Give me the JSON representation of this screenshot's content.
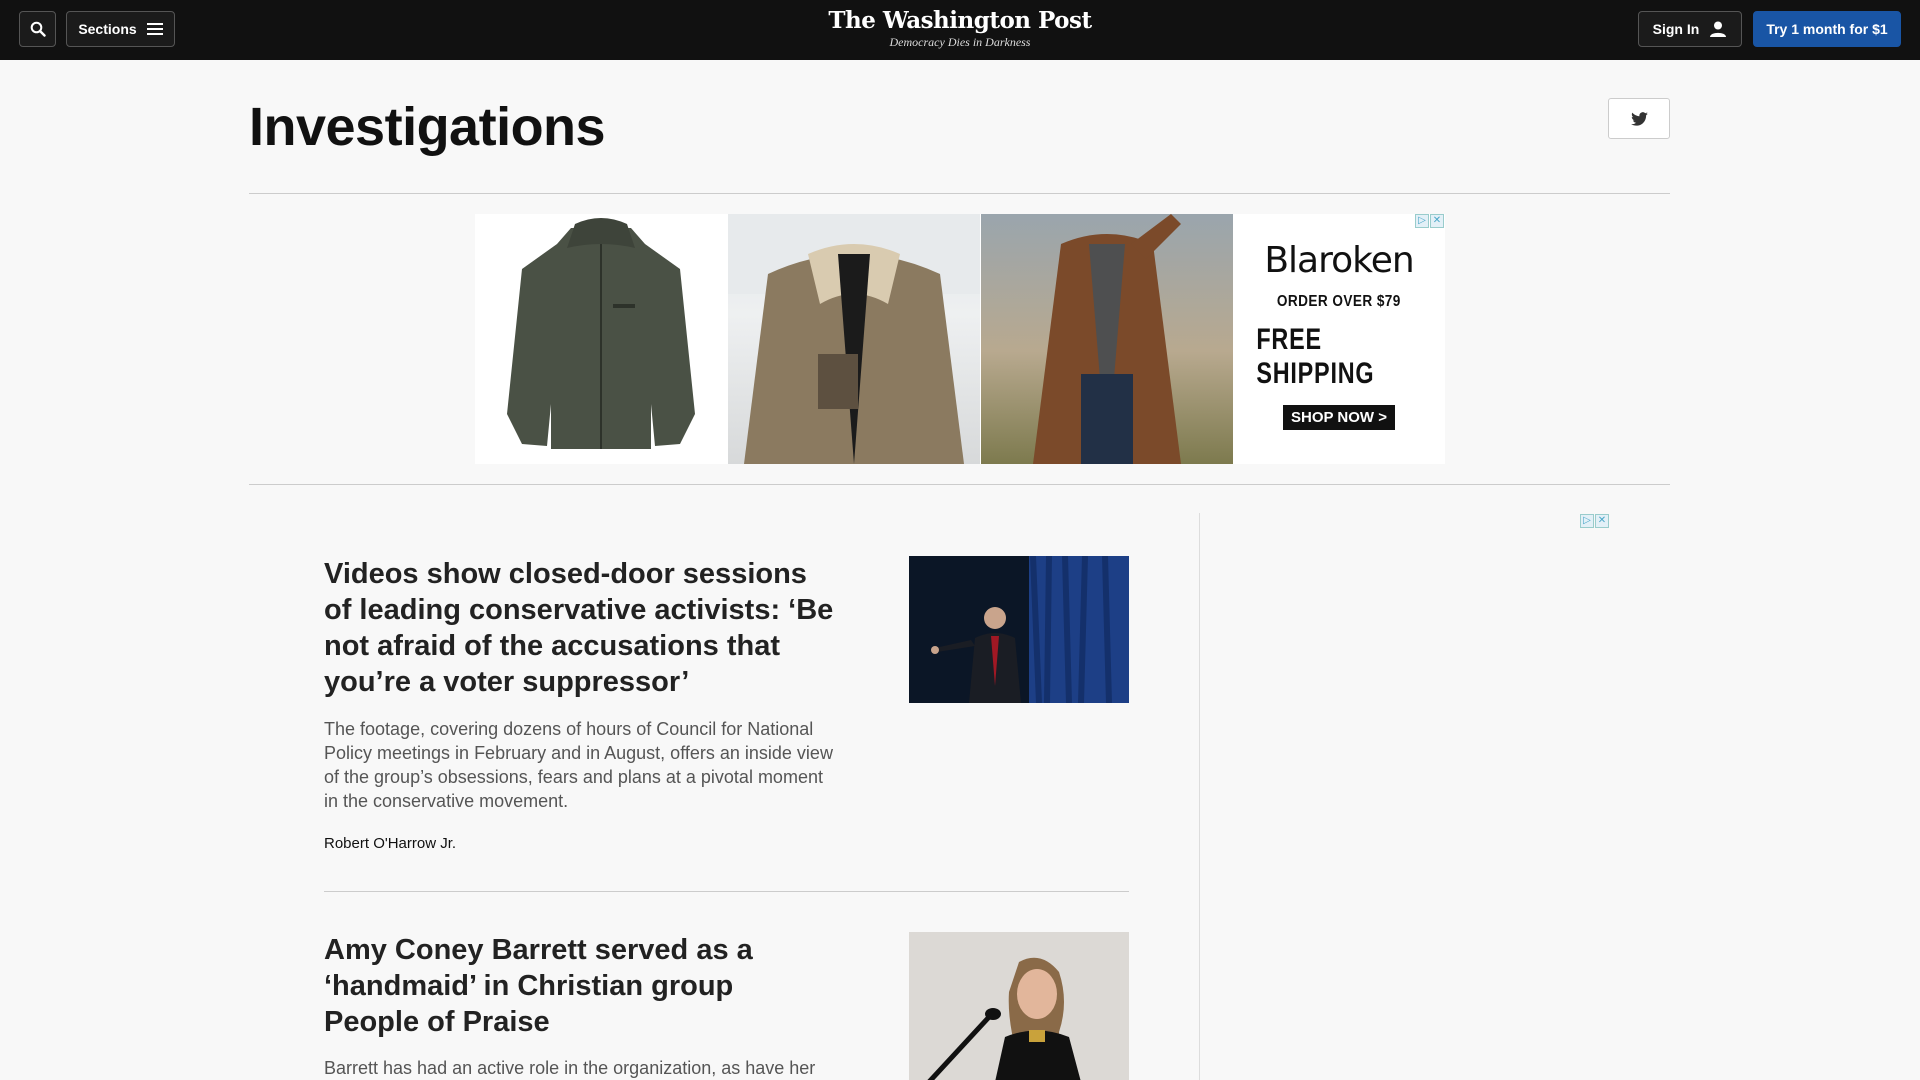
{
  "nav": {
    "sections_label": "Sections",
    "signin_label": "Sign In",
    "try_label": "Try 1 month for $1",
    "logo_title": "The Washington Post",
    "logo_tagline": "Democracy Dies in Darkness"
  },
  "page": {
    "title": "Investigations"
  },
  "ad_banner": {
    "brand": "Blaroken",
    "line1": "ORDER OVER $79",
    "line2": "FREE SHIPPING",
    "cta": "SHOP NOW >"
  },
  "articles": [
    {
      "headline": "Videos show closed-door sessions of leading conservative activists: ‘Be not afraid of the accusations that you’re a voter suppressor’",
      "blurb": "The footage, covering dozens of hours of Council for National Policy meetings in February and in August, offers an inside view of the group’s obsessions, fears and plans at a pivotal moment in the conservative movement.",
      "byline": "Robert O'Harrow Jr."
    },
    {
      "headline": "Amy Coney Barrett served as a ‘handmaid’ in Christian group People of Praise",
      "blurb": "Barrett has had an active role in the organization, as have her"
    }
  ],
  "colors": {
    "topbar": "#111111",
    "accent": "#1955a5",
    "background": "#f8f8f8"
  },
  "icons": [
    "search-icon",
    "menu-icon",
    "user-icon",
    "twitter-icon",
    "adchoices-icon",
    "close-icon"
  ]
}
